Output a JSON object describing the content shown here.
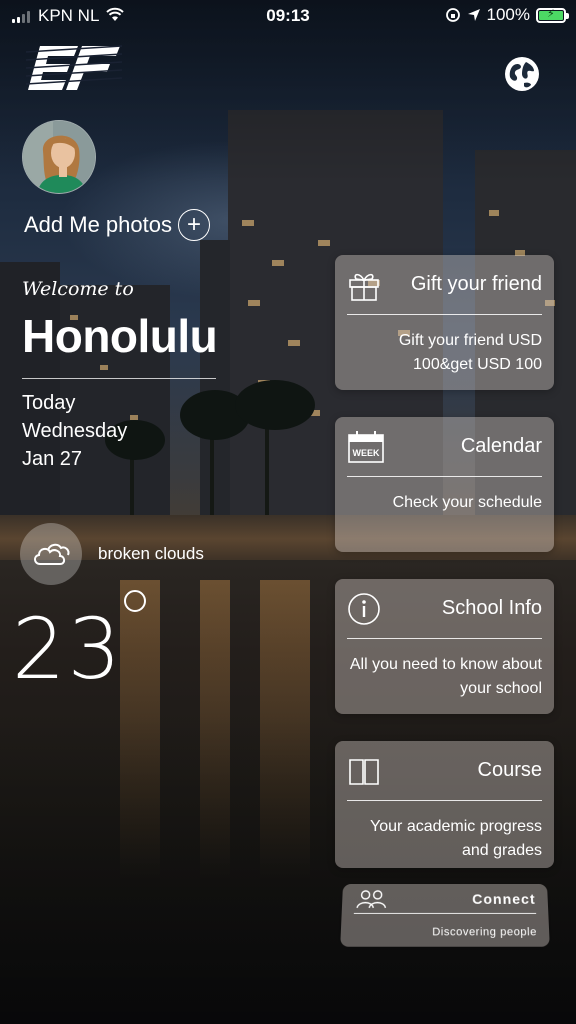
{
  "status_bar": {
    "carrier": "KPN NL",
    "time": "09:13",
    "battery": "100%"
  },
  "header": {
    "logo_icon": "ef-logo",
    "language_icon": "globe-icon"
  },
  "profile": {
    "add_photos_label": "Add Me photos",
    "add_icon_glyph": "+"
  },
  "location": {
    "welcome": "Welcome to",
    "city": "Honolulu",
    "day_label": "Today",
    "weekday": "Wednesday",
    "date": "Jan 27"
  },
  "weather": {
    "icon": "broken-clouds-icon",
    "description": "broken clouds",
    "temperature": "23"
  },
  "cards": [
    {
      "title": "Gift your friend",
      "body": "Gift your friend USD 100&get USD 100",
      "icon": "gift-icon"
    },
    {
      "title": "Calendar",
      "body": "Check your schedule",
      "icon": "calendar-week-icon",
      "icon_text": "WEEK"
    },
    {
      "title": "School Info",
      "body": "All you need to know about your school",
      "icon": "info-icon"
    },
    {
      "title": "Course",
      "body": "Your academic progress and grades",
      "icon": "book-icon"
    },
    {
      "title": "Connect",
      "body": "Discovering people",
      "icon": "people-icon"
    }
  ]
}
